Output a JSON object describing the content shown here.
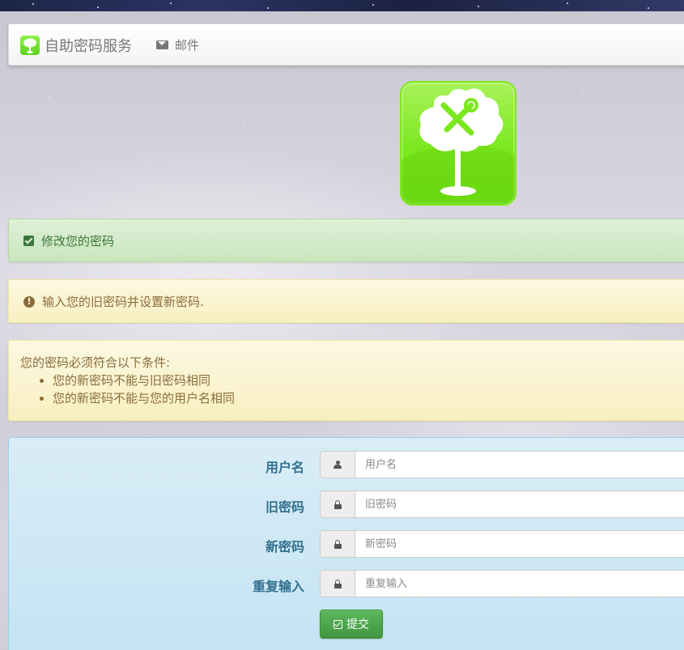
{
  "navbar": {
    "brand_title": "自助密码服务",
    "mail_label": "邮件"
  },
  "alerts": {
    "success_text": "修改您的密码",
    "warning_text": "输入您的旧密码并设置新密码.",
    "rules_title": "您的密码必须符合以下条件:",
    "rules": [
      "您的新密码不能与旧密码相同",
      "您的新密码不能与您的用户名相同"
    ]
  },
  "form": {
    "fields": [
      {
        "label": "用户名",
        "placeholder": "用户名",
        "icon": "user-icon"
      },
      {
        "label": "旧密码",
        "placeholder": "旧密码",
        "icon": "lock-icon"
      },
      {
        "label": "新密码",
        "placeholder": "新密码",
        "icon": "lock-icon"
      },
      {
        "label": "重复输入",
        "placeholder": "重复输入",
        "icon": "lock-icon"
      }
    ],
    "submit_label": "提交"
  },
  "colors": {
    "success_bg": "#dff0d8",
    "success_text": "#3c763d",
    "warning_bg": "#fcf8e3",
    "warning_text": "#8a6d3b",
    "info_bg": "#d9edf7",
    "info_text": "#31708f",
    "button_green": "#5cb85c",
    "logo_green": "#7be81f"
  }
}
